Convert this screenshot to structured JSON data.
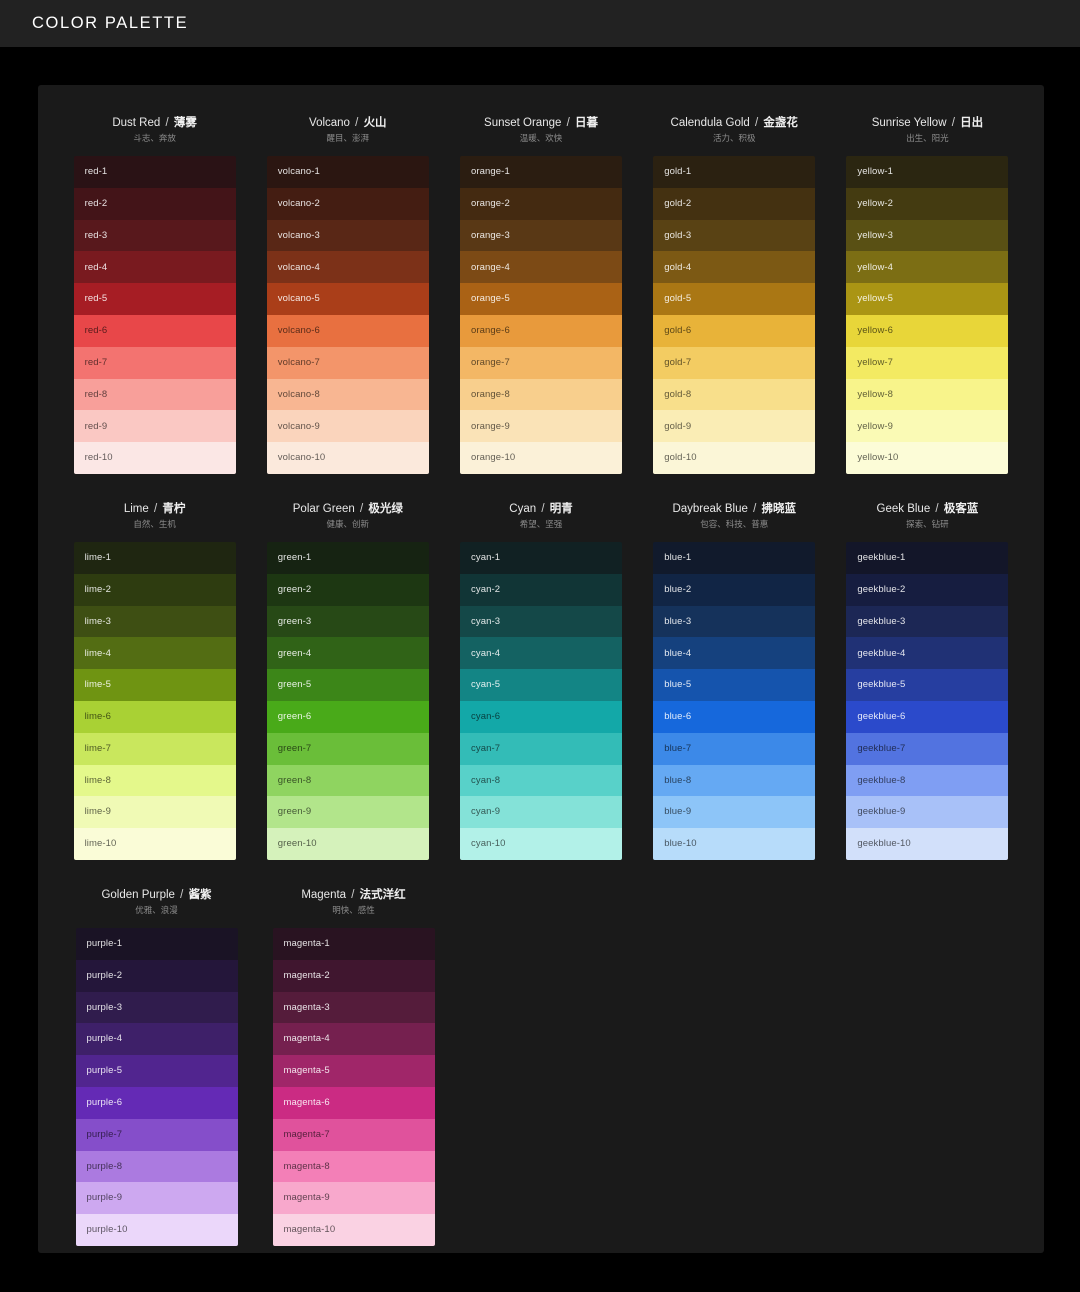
{
  "topbar": {
    "title": "COLOR PALETTE"
  },
  "theme": {
    "page_bg": "#000000",
    "topbar_bg": "#222222",
    "card_bg": "#1a1a1a",
    "title_color": "#ffffff",
    "subtitle_color": "#8c8c8c"
  },
  "palettes": [
    {
      "name_en": "Dust Red",
      "name_zh": "薄雾",
      "subtitle": "斗志、奔放",
      "key": "red",
      "swatches": [
        {
          "label": "red-1",
          "hex": "#2a1215",
          "text": "light"
        },
        {
          "label": "red-2",
          "hex": "#431418",
          "text": "light"
        },
        {
          "label": "red-3",
          "hex": "#58181c",
          "text": "light"
        },
        {
          "label": "red-4",
          "hex": "#791a1f",
          "text": "light"
        },
        {
          "label": "red-5",
          "hex": "#a61d24",
          "text": "light"
        },
        {
          "label": "red-6",
          "hex": "#e84749",
          "text": "dark"
        },
        {
          "label": "red-7",
          "hex": "#f37370",
          "text": "dark"
        },
        {
          "label": "red-8",
          "hex": "#f89f9a",
          "text": "dark"
        },
        {
          "label": "red-9",
          "hex": "#fac8c3",
          "text": "dark"
        },
        {
          "label": "red-10",
          "hex": "#fbe7e5",
          "text": "dark"
        }
      ]
    },
    {
      "name_en": "Volcano",
      "name_zh": "火山",
      "subtitle": "醒目、澎湃",
      "key": "volcano",
      "swatches": [
        {
          "label": "volcano-1",
          "hex": "#2b1611",
          "text": "light"
        },
        {
          "label": "volcano-2",
          "hex": "#441d12",
          "text": "light"
        },
        {
          "label": "volcano-3",
          "hex": "#592716",
          "text": "light"
        },
        {
          "label": "volcano-4",
          "hex": "#7c3118",
          "text": "light"
        },
        {
          "label": "volcano-5",
          "hex": "#aa3e19",
          "text": "light"
        },
        {
          "label": "volcano-6",
          "hex": "#e87040",
          "text": "dark"
        },
        {
          "label": "volcano-7",
          "hex": "#f3956a",
          "text": "dark"
        },
        {
          "label": "volcano-8",
          "hex": "#f8b692",
          "text": "dark"
        },
        {
          "label": "volcano-9",
          "hex": "#fad4bc",
          "text": "dark"
        },
        {
          "label": "volcano-10",
          "hex": "#fbe9dc",
          "text": "dark"
        }
      ]
    },
    {
      "name_en": "Sunset Orange",
      "name_zh": "日暮",
      "subtitle": "温暖、欢快",
      "key": "orange",
      "swatches": [
        {
          "label": "orange-1",
          "hex": "#2b1d11",
          "text": "light"
        },
        {
          "label": "orange-2",
          "hex": "#442a11",
          "text": "light"
        },
        {
          "label": "orange-3",
          "hex": "#593815",
          "text": "light"
        },
        {
          "label": "orange-4",
          "hex": "#7c4a15",
          "text": "light"
        },
        {
          "label": "orange-5",
          "hex": "#aa6215",
          "text": "light"
        },
        {
          "label": "orange-6",
          "hex": "#e89a3c",
          "text": "dark"
        },
        {
          "label": "orange-7",
          "hex": "#f3b765",
          "text": "dark"
        },
        {
          "label": "orange-8",
          "hex": "#f8cf8d",
          "text": "dark"
        },
        {
          "label": "orange-9",
          "hex": "#fae3b7",
          "text": "dark"
        },
        {
          "label": "orange-10",
          "hex": "#fbf1d8",
          "text": "dark"
        }
      ]
    },
    {
      "name_en": "Calendula Gold",
      "name_zh": "金盏花",
      "subtitle": "活力、积极",
      "key": "gold",
      "swatches": [
        {
          "label": "gold-1",
          "hex": "#2b2111",
          "text": "light"
        },
        {
          "label": "gold-2",
          "hex": "#443111",
          "text": "light"
        },
        {
          "label": "gold-3",
          "hex": "#594214",
          "text": "light"
        },
        {
          "label": "gold-4",
          "hex": "#7c5914",
          "text": "light"
        },
        {
          "label": "gold-5",
          "hex": "#aa7714",
          "text": "light"
        },
        {
          "label": "gold-6",
          "hex": "#e8b339",
          "text": "dark"
        },
        {
          "label": "gold-7",
          "hex": "#f3cc62",
          "text": "dark"
        },
        {
          "label": "gold-8",
          "hex": "#f8df8b",
          "text": "dark"
        },
        {
          "label": "gold-9",
          "hex": "#faedb5",
          "text": "dark"
        },
        {
          "label": "gold-10",
          "hex": "#fbf6d7",
          "text": "dark"
        }
      ]
    },
    {
      "name_en": "Sunrise Yellow",
      "name_zh": "日出",
      "subtitle": "出生、阳光",
      "key": "yellow",
      "swatches": [
        {
          "label": "yellow-1",
          "hex": "#2b2611",
          "text": "light"
        },
        {
          "label": "yellow-2",
          "hex": "#443b11",
          "text": "light"
        },
        {
          "label": "yellow-3",
          "hex": "#595014",
          "text": "light"
        },
        {
          "label": "yellow-4",
          "hex": "#7c6e14",
          "text": "light"
        },
        {
          "label": "yellow-5",
          "hex": "#aa9514",
          "text": "light"
        },
        {
          "label": "yellow-6",
          "hex": "#e8d639",
          "text": "dark"
        },
        {
          "label": "yellow-7",
          "hex": "#f3ea62",
          "text": "dark"
        },
        {
          "label": "yellow-8",
          "hex": "#f8f48b",
          "text": "dark"
        },
        {
          "label": "yellow-9",
          "hex": "#fafab5",
          "text": "dark"
        },
        {
          "label": "yellow-10",
          "hex": "#fcfcd7",
          "text": "dark"
        }
      ]
    },
    {
      "name_en": "Lime",
      "name_zh": "青柠",
      "subtitle": "自然、生机",
      "key": "lime",
      "swatches": [
        {
          "label": "lime-1",
          "hex": "#1f2611",
          "text": "light"
        },
        {
          "label": "lime-2",
          "hex": "#2e3c10",
          "text": "light"
        },
        {
          "label": "lime-3",
          "hex": "#3e4f13",
          "text": "light"
        },
        {
          "label": "lime-4",
          "hex": "#536d13",
          "text": "light"
        },
        {
          "label": "lime-5",
          "hex": "#6f9412",
          "text": "light"
        },
        {
          "label": "lime-6",
          "hex": "#a9d134",
          "text": "dark"
        },
        {
          "label": "lime-7",
          "hex": "#c9e75d",
          "text": "dark"
        },
        {
          "label": "lime-8",
          "hex": "#e4f88b",
          "text": "dark"
        },
        {
          "label": "lime-9",
          "hex": "#f0fab5",
          "text": "dark"
        },
        {
          "label": "lime-10",
          "hex": "#fafcd7",
          "text": "dark"
        }
      ]
    },
    {
      "name_en": "Polar Green",
      "name_zh": "极光绿",
      "subtitle": "健康、创新",
      "key": "green",
      "swatches": [
        {
          "label": "green-1",
          "hex": "#162312",
          "text": "light"
        },
        {
          "label": "green-2",
          "hex": "#1d3712",
          "text": "light"
        },
        {
          "label": "green-3",
          "hex": "#274916",
          "text": "light"
        },
        {
          "label": "green-4",
          "hex": "#306317",
          "text": "light"
        },
        {
          "label": "green-5",
          "hex": "#3c8618",
          "text": "light"
        },
        {
          "label": "green-6",
          "hex": "#49aa19",
          "text": "light"
        },
        {
          "label": "green-7",
          "hex": "#6abe39",
          "text": "dark"
        },
        {
          "label": "green-8",
          "hex": "#8fd460",
          "text": "dark"
        },
        {
          "label": "green-9",
          "hex": "#b2e58b",
          "text": "dark"
        },
        {
          "label": "green-10",
          "hex": "#d5f2bb",
          "text": "dark"
        }
      ]
    },
    {
      "name_en": "Cyan",
      "name_zh": "明青",
      "subtitle": "希望、坚强",
      "key": "cyan",
      "swatches": [
        {
          "label": "cyan-1",
          "hex": "#112123",
          "text": "light"
        },
        {
          "label": "cyan-2",
          "hex": "#113536",
          "text": "light"
        },
        {
          "label": "cyan-3",
          "hex": "#144848",
          "text": "light"
        },
        {
          "label": "cyan-4",
          "hex": "#146262",
          "text": "light"
        },
        {
          "label": "cyan-5",
          "hex": "#138585",
          "text": "light"
        },
        {
          "label": "cyan-6",
          "hex": "#13a8a8",
          "text": "dark"
        },
        {
          "label": "cyan-7",
          "hex": "#33bcb7",
          "text": "dark"
        },
        {
          "label": "cyan-8",
          "hex": "#58d1c9",
          "text": "dark"
        },
        {
          "label": "cyan-9",
          "hex": "#84e2d8",
          "text": "dark"
        },
        {
          "label": "cyan-10",
          "hex": "#b2f1e8",
          "text": "dark"
        }
      ]
    },
    {
      "name_en": "Daybreak Blue",
      "name_zh": "拂晓蓝",
      "subtitle": "包容、科技、普惠",
      "key": "blue",
      "swatches": [
        {
          "label": "blue-1",
          "hex": "#111a2c",
          "text": "light"
        },
        {
          "label": "blue-2",
          "hex": "#112545",
          "text": "light"
        },
        {
          "label": "blue-3",
          "hex": "#15325b",
          "text": "light"
        },
        {
          "label": "blue-4",
          "hex": "#15417e",
          "text": "light"
        },
        {
          "label": "blue-5",
          "hex": "#1554ad",
          "text": "light"
        },
        {
          "label": "blue-6",
          "hex": "#1668dc",
          "text": "light"
        },
        {
          "label": "blue-7",
          "hex": "#3c89e8",
          "text": "dark"
        },
        {
          "label": "blue-8",
          "hex": "#65a9f3",
          "text": "dark"
        },
        {
          "label": "blue-9",
          "hex": "#8dc5f8",
          "text": "dark"
        },
        {
          "label": "blue-10",
          "hex": "#b7dcfa",
          "text": "dark"
        }
      ]
    },
    {
      "name_en": "Geek Blue",
      "name_zh": "极客蓝",
      "subtitle": "探索、钻研",
      "key": "geekblue",
      "swatches": [
        {
          "label": "geekblue-1",
          "hex": "#131629",
          "text": "light"
        },
        {
          "label": "geekblue-2",
          "hex": "#161d40",
          "text": "light"
        },
        {
          "label": "geekblue-3",
          "hex": "#1c2755",
          "text": "light"
        },
        {
          "label": "geekblue-4",
          "hex": "#203175",
          "text": "light"
        },
        {
          "label": "geekblue-5",
          "hex": "#263ea0",
          "text": "light"
        },
        {
          "label": "geekblue-6",
          "hex": "#2b4acb",
          "text": "light"
        },
        {
          "label": "geekblue-7",
          "hex": "#5273e0",
          "text": "dark"
        },
        {
          "label": "geekblue-8",
          "hex": "#7f9ef3",
          "text": "dark"
        },
        {
          "label": "geekblue-9",
          "hex": "#a8c1f8",
          "text": "dark"
        },
        {
          "label": "geekblue-10",
          "hex": "#d2e0fa",
          "text": "dark"
        }
      ]
    },
    {
      "name_en": "Golden Purple",
      "name_zh": "酱紫",
      "subtitle": "优雅、浪漫",
      "key": "purple",
      "swatches": [
        {
          "label": "purple-1",
          "hex": "#1a1325",
          "text": "light"
        },
        {
          "label": "purple-2",
          "hex": "#24163a",
          "text": "light"
        },
        {
          "label": "purple-3",
          "hex": "#301c4d",
          "text": "light"
        },
        {
          "label": "purple-4",
          "hex": "#3e2069",
          "text": "light"
        },
        {
          "label": "purple-5",
          "hex": "#51258f",
          "text": "light"
        },
        {
          "label": "purple-6",
          "hex": "#642ab5",
          "text": "light"
        },
        {
          "label": "purple-7",
          "hex": "#854eca",
          "text": "dark"
        },
        {
          "label": "purple-8",
          "hex": "#ab7ae0",
          "text": "dark"
        },
        {
          "label": "purple-9",
          "hex": "#cda8f0",
          "text": "dark"
        },
        {
          "label": "purple-10",
          "hex": "#ebd7fa",
          "text": "dark"
        }
      ]
    },
    {
      "name_en": "Magenta",
      "name_zh": "法式洋红",
      "subtitle": "明快、感性",
      "key": "magenta",
      "swatches": [
        {
          "label": "magenta-1",
          "hex": "#291321",
          "text": "light"
        },
        {
          "label": "magenta-2",
          "hex": "#40162f",
          "text": "light"
        },
        {
          "label": "magenta-3",
          "hex": "#551c3b",
          "text": "light"
        },
        {
          "label": "magenta-4",
          "hex": "#75204f",
          "text": "light"
        },
        {
          "label": "magenta-5",
          "hex": "#a02669",
          "text": "light"
        },
        {
          "label": "magenta-6",
          "hex": "#cb2b83",
          "text": "light"
        },
        {
          "label": "magenta-7",
          "hex": "#e0529c",
          "text": "dark"
        },
        {
          "label": "magenta-8",
          "hex": "#f37fb7",
          "text": "dark"
        },
        {
          "label": "magenta-9",
          "hex": "#f8a8cc",
          "text": "dark"
        },
        {
          "label": "magenta-10",
          "hex": "#fad2e3",
          "text": "dark"
        }
      ]
    }
  ],
  "layout": {
    "rows": [
      [
        0,
        1,
        2,
        3,
        4
      ],
      [
        5,
        6,
        7,
        8,
        9
      ],
      [
        10,
        11
      ]
    ]
  }
}
